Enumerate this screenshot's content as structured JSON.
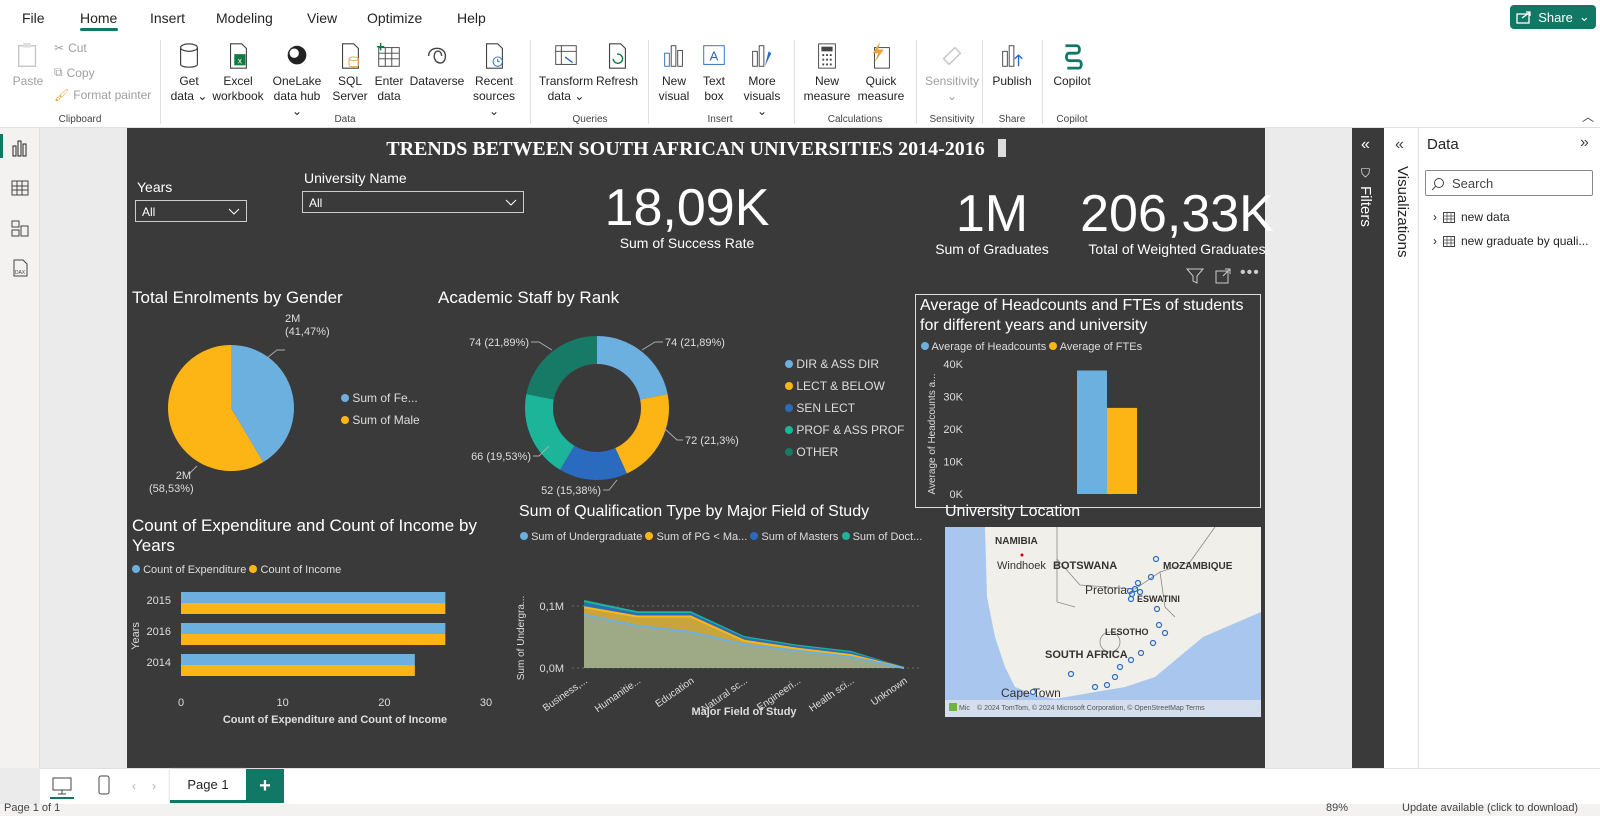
{
  "menu": {
    "items": [
      "File",
      "Home",
      "Insert",
      "Modeling",
      "View",
      "Optimize",
      "Help"
    ],
    "share": "Share"
  },
  "ribbon": {
    "clipboard": {
      "paste": "Paste",
      "cut": "Cut",
      "copy": "Copy",
      "format_painter": "Format painter",
      "group": "Clipboard"
    },
    "data": {
      "get_data": [
        "Get",
        "data"
      ],
      "excel": [
        "Excel",
        "workbook"
      ],
      "onelake": [
        "OneLake",
        "data hub"
      ],
      "sql": [
        "SQL",
        "Server"
      ],
      "enter": [
        "Enter",
        "data"
      ],
      "dataverse": "Dataverse",
      "recent": [
        "Recent",
        "sources"
      ],
      "group": "Data"
    },
    "queries": {
      "transform": [
        "Transform",
        "data"
      ],
      "refresh": "Refresh",
      "group": "Queries"
    },
    "insert": {
      "new_visual": [
        "New",
        "visual"
      ],
      "text_box": [
        "Text",
        "box"
      ],
      "more_visuals": [
        "More",
        "visuals"
      ],
      "group": "Insert"
    },
    "calculations": {
      "new_measure": [
        "New",
        "measure"
      ],
      "quick_measure": [
        "Quick",
        "measure"
      ],
      "group": "Calculations"
    },
    "sensitivity": {
      "label": "Sensitivity",
      "group": "Sensitivity"
    },
    "share": {
      "publish": "Publish",
      "group": "Share"
    },
    "copilot": {
      "label": "Copilot",
      "group": "Copilot"
    }
  },
  "report": {
    "title": "TRENDS BETWEEN SOUTH AFRICAN UNIVERSITIES 2014-2016",
    "slicers": [
      {
        "label": "Years",
        "value": "All"
      },
      {
        "label": "University Name",
        "value": "All"
      }
    ],
    "kpis": [
      {
        "value": "18,09K",
        "label": "Sum of Success Rate"
      },
      {
        "value": "1M",
        "label": "Sum of Graduates"
      },
      {
        "value": "206,33K",
        "label": "Total of Weighted Graduates"
      }
    ]
  },
  "charts": {
    "gender": {
      "title": "Total Enrolments by Gender",
      "legend": [
        "Sum of Fe...",
        "Sum of Male"
      ],
      "labels": [
        [
          "2M",
          "(41,47%)"
        ],
        [
          "2M",
          "(58,53%)"
        ]
      ]
    },
    "staff": {
      "title": "Academic Staff by Rank",
      "legend": [
        "DIR & ASS DIR",
        "LECT & BELOW",
        "SEN LECT",
        "PROF & ASS PROF",
        "OTHER"
      ],
      "labels": [
        "74 (21,89%)",
        "72 (21,3%)",
        "52 (15,38%)",
        "66 (19,53%)",
        "74 (21,89%)"
      ]
    },
    "headcounts": {
      "title": [
        "Average of Headcounts and FTEs of students",
        "for different years and university"
      ],
      "legend": [
        "Average of Headcounts",
        "Average of FTEs"
      ],
      "yaxis_title": "Average of Headcounts a...",
      "ticks": [
        "40K",
        "30K",
        "20K",
        "10K",
        "0K"
      ]
    },
    "expenditure": {
      "title": [
        "Count of Expenditure and Count of Income by",
        "Years"
      ],
      "legend": [
        "Count of Expenditure",
        "Count of Income"
      ],
      "ylabel": "Years",
      "xlabel": "Count of Expenditure and Count of Income",
      "xticks": [
        "0",
        "10",
        "20",
        "30"
      ]
    },
    "qualification": {
      "title": "Sum of Qualification Type by Major Field of Study",
      "legend": [
        "Sum of Undergraduate",
        "Sum of PG < Ma...",
        "Sum of Masters",
        "Sum of Doct..."
      ],
      "ylabel": "Sum of Undergra...",
      "xlabel": "Major Field of Study",
      "yticks": [
        "0,1M",
        "0,0M"
      ]
    },
    "map": {
      "title": "University Location",
      "places": [
        "NAMIBIA",
        "Windhoek",
        "BOTSWANA",
        "MOZAMBIQUE",
        "Pretoria",
        "ESWATINI",
        "LESOTHO",
        "SOUTH AFRICA",
        "Cape Town"
      ],
      "copyright": "© 2024 TomTom, © 2024 Microsoft Corporation, © OpenStreetMap  Terms",
      "ms": "Mic"
    }
  },
  "chart_data": [
    {
      "type": "pie",
      "title": "Total Enrolments by Gender",
      "categories": [
        "Sum of Fe...",
        "Sum of Male"
      ],
      "values": [
        41.47,
        58.53
      ],
      "colors": [
        "#6cb0e0",
        "#fdb515"
      ]
    },
    {
      "type": "pie",
      "title": "Academic Staff by Rank",
      "donut": true,
      "categories": [
        "DIR & ASS DIR",
        "LECT & BELOW",
        "SEN LECT",
        "PROF & ASS PROF",
        "OTHER"
      ],
      "values": [
        74,
        72,
        52,
        66,
        74
      ],
      "colors": [
        "#6cb0e0",
        "#fdb515",
        "#2a6bbf",
        "#1cb59a",
        "#177a66"
      ]
    },
    {
      "type": "bar",
      "title": "Average of Headcounts and FTEs of students for different years and university",
      "categories": [
        ""
      ],
      "series": [
        {
          "name": "Average of Headcounts",
          "values": [
            38000
          ]
        },
        {
          "name": "Average of FTEs",
          "values": [
            26500
          ]
        }
      ],
      "ylim": [
        0,
        40000
      ]
    },
    {
      "type": "bar",
      "orientation": "horizontal",
      "title": "Count of Expenditure and Count of Income by Years",
      "categories": [
        "2015",
        "2016",
        "2014"
      ],
      "series": [
        {
          "name": "Count of Expenditure",
          "values": [
            26,
            26,
            23
          ]
        },
        {
          "name": "Count of Income",
          "values": [
            26,
            26,
            23
          ]
        }
      ],
      "xlim": [
        0,
        30
      ]
    },
    {
      "type": "area",
      "title": "Sum of Qualification Type by Major Field of Study",
      "categories": [
        "Business,...",
        "Humanitie...",
        "Education",
        "Natural sc...",
        "Engineeri...",
        "Health sci...",
        "Unknown"
      ],
      "series": [
        {
          "name": "Sum of Undergraduate",
          "values": [
            0.086,
            0.068,
            0.058,
            0.038,
            0.028,
            0.018,
            0.0
          ]
        },
        {
          "name": "Sum of PG < Ma...",
          "values": [
            0.098,
            0.083,
            0.083,
            0.044,
            0.031,
            0.021,
            0.0
          ]
        },
        {
          "name": "Sum of Masters",
          "values": [
            0.104,
            0.087,
            0.087,
            0.048,
            0.034,
            0.024,
            0.0
          ]
        },
        {
          "name": "Sum of Doct...",
          "values": [
            0.108,
            0.09,
            0.09,
            0.05,
            0.036,
            0.026,
            0.0
          ]
        }
      ],
      "yticks": [
        "0,0M",
        "0,1M"
      ]
    }
  ],
  "panes": {
    "filters": "Filters",
    "visualizations": "Visualizations",
    "data_title": "Data",
    "search_placeholder": "Search",
    "tables": [
      "new data",
      "new graduate by quali..."
    ]
  },
  "bottom": {
    "page": "Page 1",
    "add": "+"
  },
  "status": {
    "page": "Page 1 of 1",
    "zoom": "89%",
    "update": "Update available (click to download)"
  }
}
